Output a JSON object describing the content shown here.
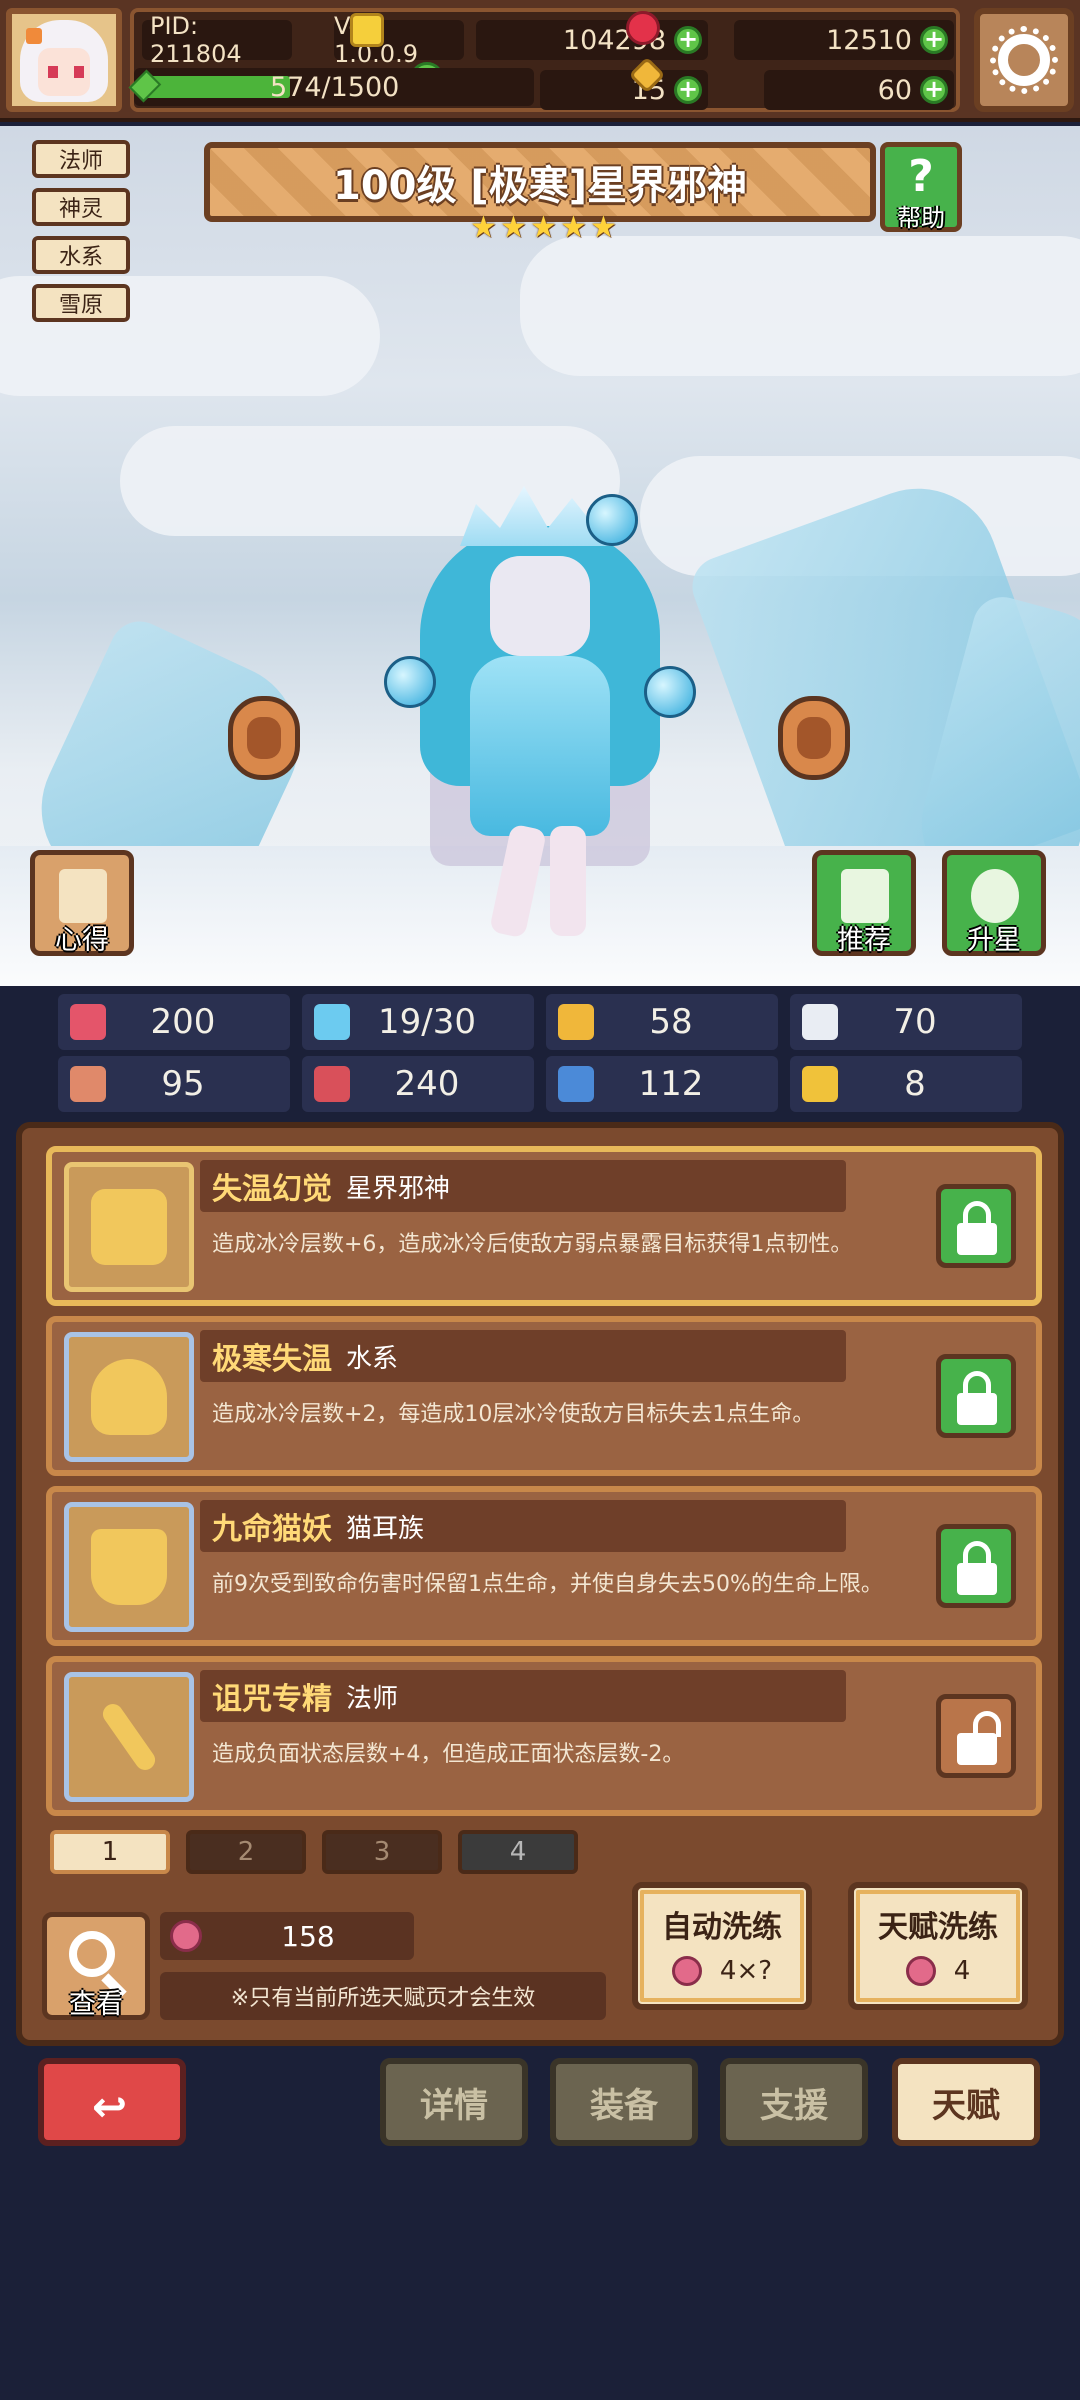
{
  "topbar": {
    "pid": "PID: 211804",
    "version": "Ver: 1.0.0.9",
    "coins": "104298",
    "gems": "12510",
    "xp_text": "574/1500",
    "xp_progress": 0.383,
    "clovers": "15",
    "keys": "60"
  },
  "hero": {
    "tags": [
      "法师",
      "神灵",
      "水系",
      "雪原"
    ],
    "title": "100级  [极寒]星界邪神",
    "stars": 5,
    "help_label": "帮助",
    "tips_label": "心得",
    "recommend_label": "推荐",
    "upgrade_label": "升星"
  },
  "stats": [
    {
      "icon": "heart-icon",
      "value": "200",
      "color": "#e4556a"
    },
    {
      "icon": "water-drop-icon",
      "value": "19/30",
      "color": "#6ccbf0"
    },
    {
      "icon": "shield-icon",
      "value": "58",
      "color": "#f0b73a"
    },
    {
      "icon": "wing-icon",
      "value": "70",
      "color": "#e9edf3"
    },
    {
      "icon": "fist-icon",
      "value": "95",
      "color": "#e0896a"
    },
    {
      "icon": "spellbook-icon",
      "value": "240",
      "color": "#d9505a"
    },
    {
      "icon": "boot-icon",
      "value": "112",
      "color": "#4b8ad8"
    },
    {
      "icon": "horseshoe-icon",
      "value": "8",
      "color": "#f0c23a"
    }
  ],
  "talents": [
    {
      "name": "失温幻觉",
      "tag": "星界邪神",
      "desc": "造成冰冷层数+6，造成冰冷后使敌方弱点暴露目标获得1点韧性。",
      "icon": "star-icon",
      "locked": true
    },
    {
      "name": "极寒失温",
      "tag": "水系",
      "desc": "造成冰冷层数+2，每造成10层冰冷使敌方目标失去1点生命。",
      "icon": "flame-icon",
      "locked": true
    },
    {
      "name": "九命猫妖",
      "tag": "猫耳族",
      "desc": "前9次受到致命伤害时保留1点生命，并使自身失去50%的生命上限。",
      "icon": "cat-icon",
      "locked": true
    },
    {
      "name": "诅咒专精",
      "tag": "法师",
      "desc": "造成负面状态层数+4，但造成正面状态层数-2。",
      "icon": "staff-icon",
      "locked": false
    }
  ],
  "pages": [
    "1",
    "2",
    "3",
    "4"
  ],
  "bottom": {
    "view_label": "查看",
    "fruit_count": "158",
    "note": "※只有当前所选天赋页才会生效",
    "auto_reroll_label": "自动洗练",
    "auto_reroll_cost": "4×?",
    "talent_reroll_label": "天赋洗练",
    "talent_reroll_cost": "4"
  },
  "nav": {
    "details": "详情",
    "equipment": "装备",
    "support": "支援",
    "talent": "天赋"
  }
}
